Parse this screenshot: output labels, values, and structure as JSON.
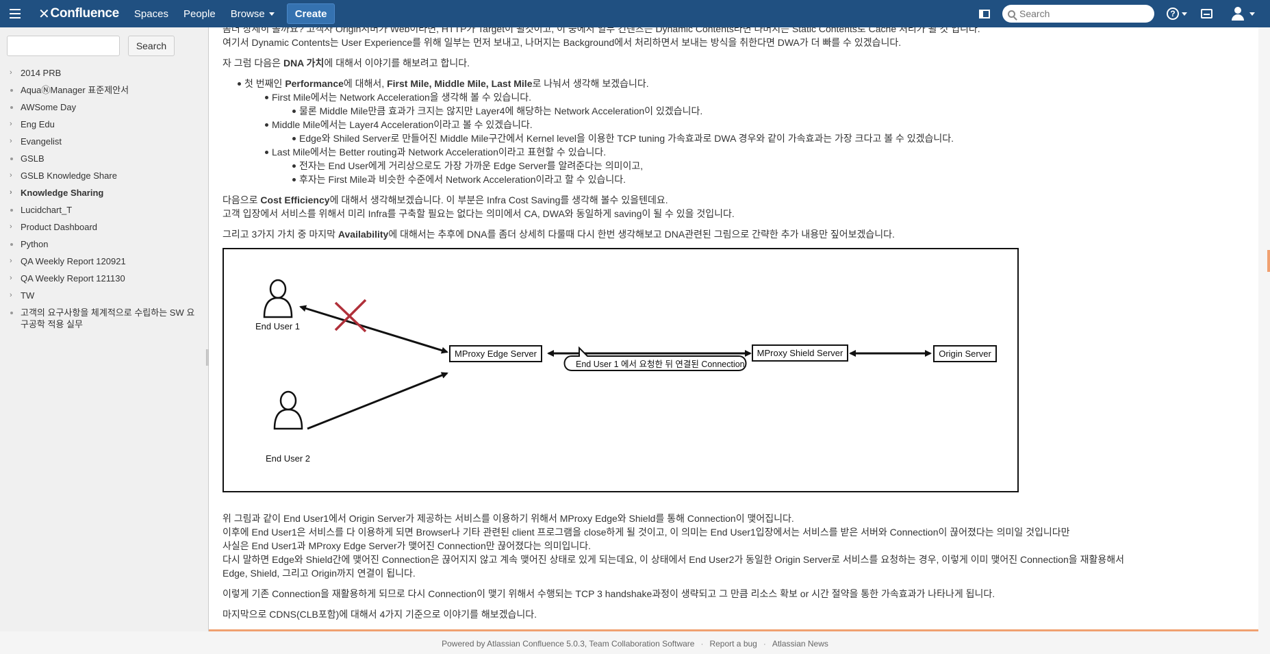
{
  "header": {
    "logo": "Confluence",
    "nav": [
      "Spaces",
      "People",
      "Browse"
    ],
    "create_label": "Create",
    "search_placeholder": "Search",
    "help_glyph": "?"
  },
  "sidebar": {
    "search_button": "Search",
    "items": [
      {
        "label": "2014 PRB",
        "expand": true,
        "bold": false
      },
      {
        "label": "AquaⓃManager 표준제안서",
        "expand": false,
        "bold": false
      },
      {
        "label": "AWSome Day",
        "expand": false,
        "bold": false
      },
      {
        "label": "Eng Edu",
        "expand": true,
        "bold": false
      },
      {
        "label": "Evangelist",
        "expand": true,
        "bold": false
      },
      {
        "label": "GSLB",
        "expand": false,
        "bold": false
      },
      {
        "label": "GSLB Knowledge Share",
        "expand": true,
        "bold": false
      },
      {
        "label": "Knowledge Sharing",
        "expand": true,
        "bold": true
      },
      {
        "label": "Lucidchart_T",
        "expand": false,
        "bold": false
      },
      {
        "label": "Product Dashboard",
        "expand": true,
        "bold": false
      },
      {
        "label": "Python",
        "expand": false,
        "bold": false
      },
      {
        "label": "QA Weekly Report 120921",
        "expand": true,
        "bold": false
      },
      {
        "label": "QA Weekly Report 121130",
        "expand": true,
        "bold": false
      },
      {
        "label": "TW",
        "expand": true,
        "bold": false
      },
      {
        "label": "고객의 요구사항을 체계적으로 수립하는 SW 요구공학 적용 실무",
        "expand": false,
        "bold": false
      }
    ]
  },
  "content": {
    "p0_line1": "좀더 상세히 볼까요? 고객사 Origin서버가 Web이라면, HTTP가 Target이 될것이고, 이 중에서 일부 컨텐츠는 Dynamic Contents라면 나머지는 Static Contents로 Cache 처리가 될 것 입니다.",
    "p0_line2": "여기서 Dynamic Contents는 User Experience를 위해 일부는 먼저 보내고, 나머지는 Background에서 처리하면서 보내는 방식을 취한다면 DWA가 더 빠를 수 있겠습니다.",
    "p1_a": "자 그럼 다음은 ",
    "p1_b": "DNA 가치",
    "p1_c": "에 대해서 이야기를 해보려고 합니다.",
    "b1_a": "첫 번째인 ",
    "b1_b": "Performance",
    "b1_c": "에 대해서, ",
    "b1_d": "First Mile, Middle Mile, Last Mile",
    "b1_e": "로 나눠서 생각해 보겠습니다.",
    "b2": "First Mile에서는 Network Acceleration을 생각해 볼 수 있습니다.",
    "b3": "물론 Middle Mile만큼 효과가 크지는 않지만 Layer4에 해당하는 Network Acceleration이 있겠습니다.",
    "b4": "Middle Mile에서는 Layer4 Acceleration이라고 볼 수 있겠습니다.",
    "b5": "Edge와 Shiled Server로 만들어진 Middle Mile구간에서 Kernel level을 이용한 TCP tuning 가속효과로 DWA 경우와 같이 가속효과는 가장 크다고 볼 수 있겠습니다.",
    "b6": "Last Mile에서는 Better routing과 Network Acceleration이라고 표현할 수 있습니다.",
    "b7": "전자는 End User에게 거리상으로도 가장 가까운 Edge Server를 알려준다는 의미이고,",
    "b8": "후자는 First Mile과 비슷한 수준에서 Network Acceleration이라고 할 수 있습니다.",
    "p2_a": "다음으로 ",
    "p2_b": "Cost Efficiency",
    "p2_c": "에 대해서 생각해보겠습니다. 이 부분은 Infra Cost Saving를 생각해 볼수 있을텐데요.",
    "p2_line2": "고객 입장에서 서비스를 위해서 미리 Infra를 구축할 필요는 없다는 의미에서 CA, DWA와 동일하게 saving이 될 수 있을 것입니다.",
    "p3_a": "그리고 3가지 가치 중 마지막 ",
    "p3_b": "Availability",
    "p3_c": "에 대해서는 추후에 DNA를 좀더 상세히 다룰때 다시 한번 생각해보고 DNA관련된 그림으로 간략한 추가 내용만 짚어보겠습니다.",
    "p4_l1": "위 그림과 같이 End User1에서 Origin Server가 제공하는 서비스를 이용하기 위해서 MProxy Edge와 Shield를 통해 Connection이 맺어집니다.",
    "p4_l2": "이후에 End User1은 서비스를 다 이용하게 되면 Browser나 기타 관련된 client 프로그램을 close하게 될 것이고, 이 의미는 End User1입장에서는 서비스를 받은 서버와 Connection이 끊어졌다는 의미일 것입니다만",
    "p4_l3": "사실은 End User1과 MProxy Edge Server가 맺어진 Connection만 끊어졌다는 의미입니다.",
    "p4_l4": "다시 말하면 Edge와 Shield간에 맺어진 Connection은 끊어지지 않고 계속 맺어진 상태로 있게 되는데요, 이 상태에서 End User2가 동일한 Origin Server로 서비스를 요청하는 경우, 이렇게 이미 맺어진 Connection을 재활용해서",
    "p4_l5": "Edge, Shield, 그리고 Origin까지 연결이 됩니다.",
    "p5": "이렇게 기존 Connection을 재활용하게 되므로 다시 Connection이 맺기 위해서 수행되는 TCP 3 handshake과정이 생략되고 그 만큼 리소스 확보 or 시간 절약을 통한 가속효과가 나타나게 됩니다.",
    "p6": "마지막으로 CDNS(CLB포함)에 대해서 4가지 기준으로 이야기를 해보겠습니다."
  },
  "diagram": {
    "end_user_1": "End User 1",
    "end_user_2": "End User 2",
    "edge_server": "MProxy Edge Server",
    "shield_server": "MProxy Shield Server",
    "origin_server": "Origin Server",
    "bubble": "End User 1 에서 요청한 뒤 연결된 Connection",
    "x_color": "#b0303a"
  },
  "footer": {
    "powered": "Powered by Atlassian Confluence 5.0.3, Team Collaboration Software",
    "sep": "·",
    "report": "Report a bug",
    "news": "Atlassian News"
  }
}
